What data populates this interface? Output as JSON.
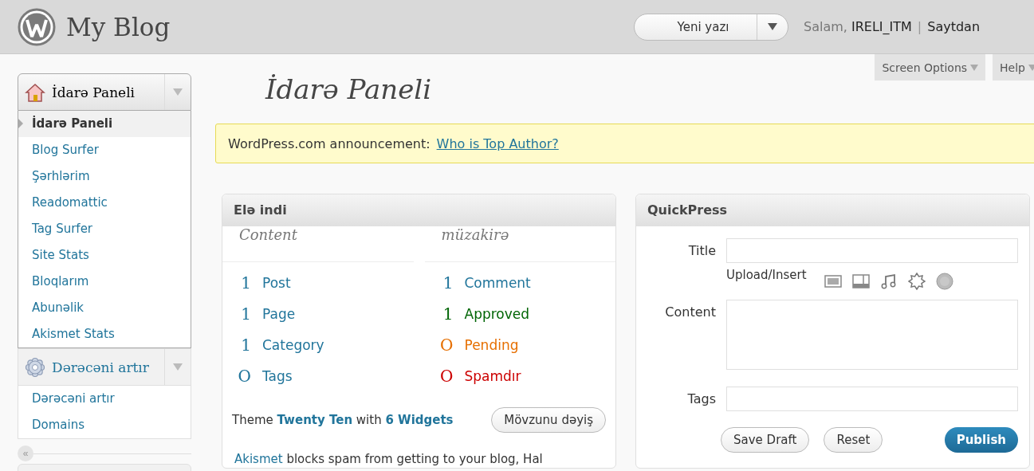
{
  "header": {
    "site_title": "My Blog",
    "new_post": "Yeni yazı",
    "greeting": "Salam,",
    "user": "IRELI_ITM",
    "separator": "|",
    "logout": "Saytdan"
  },
  "screen_tabs": [
    {
      "label": "Screen Options"
    },
    {
      "label": "Help"
    }
  ],
  "sidebar": {
    "menus": [
      {
        "label": "İdarə Paneli",
        "current": true,
        "expanded": true,
        "items": [
          {
            "label": "İdarə Paneli",
            "selected": true
          },
          {
            "label": "Blog Surfer",
            "selected": false
          },
          {
            "label": "Şərhlərim",
            "selected": false
          },
          {
            "label": "Readomattic",
            "selected": false
          },
          {
            "label": "Tag Surfer",
            "selected": false
          },
          {
            "label": "Site Stats",
            "selected": false
          },
          {
            "label": "Bloqlarım",
            "selected": false
          },
          {
            "label": "Abunəlik",
            "selected": false
          },
          {
            "label": "Akismet Stats",
            "selected": false
          }
        ]
      },
      {
        "label": "Dərəcəni artır",
        "current": false,
        "expanded": true,
        "items": [
          {
            "label": "Dərəcəni artır",
            "selected": false
          },
          {
            "label": "Domains",
            "selected": false
          }
        ]
      }
    ],
    "collapse": "«"
  },
  "page_title": "İdarə Paneli",
  "announcement": {
    "text": "WordPress.com announcement:",
    "link": "Who is Top Author?"
  },
  "right_now": {
    "title": "Elə indi",
    "columns": [
      {
        "heading": "Content",
        "rows": [
          {
            "count": "1",
            "label": "Post",
            "color": "#21759b"
          },
          {
            "count": "1",
            "label": "Page",
            "color": "#21759b"
          },
          {
            "count": "1",
            "label": "Category",
            "color": "#21759b"
          },
          {
            "count": "O",
            "label": "Tags",
            "color": "#21759b"
          }
        ]
      },
      {
        "heading": "müzakirə",
        "rows": [
          {
            "count": "1",
            "label": "Comment",
            "color": "#21759b"
          },
          {
            "count": "1",
            "label": "Approved",
            "color": "#006505"
          },
          {
            "count": "O",
            "label": "Pending",
            "color": "#e66f00"
          },
          {
            "count": "O",
            "label": "Spamdır",
            "color": "#cc0000"
          }
        ]
      }
    ],
    "theme_line": [
      {
        "kind": "text",
        "text": "Theme"
      },
      {
        "kind": "link",
        "text": "Twenty Ten"
      },
      {
        "kind": "text",
        "text": "with"
      },
      {
        "kind": "link",
        "text": "6 Widgets"
      }
    ],
    "theme_button": "Mövzunu dəyiş",
    "akismet": {
      "link": "Akismet",
      "text": "blocks spam from getting to your blog, Hal"
    }
  },
  "quickpress": {
    "title": "QuickPress",
    "title_label": "Title",
    "upload_label": "Upload/Insert",
    "content_label": "Content",
    "tags_label": "Tags",
    "buttons": [
      {
        "label": "Save Draft",
        "kind": "secondary"
      },
      {
        "label": "Reset",
        "kind": "secondary"
      },
      {
        "label": "Publish",
        "kind": "primary"
      }
    ]
  }
}
